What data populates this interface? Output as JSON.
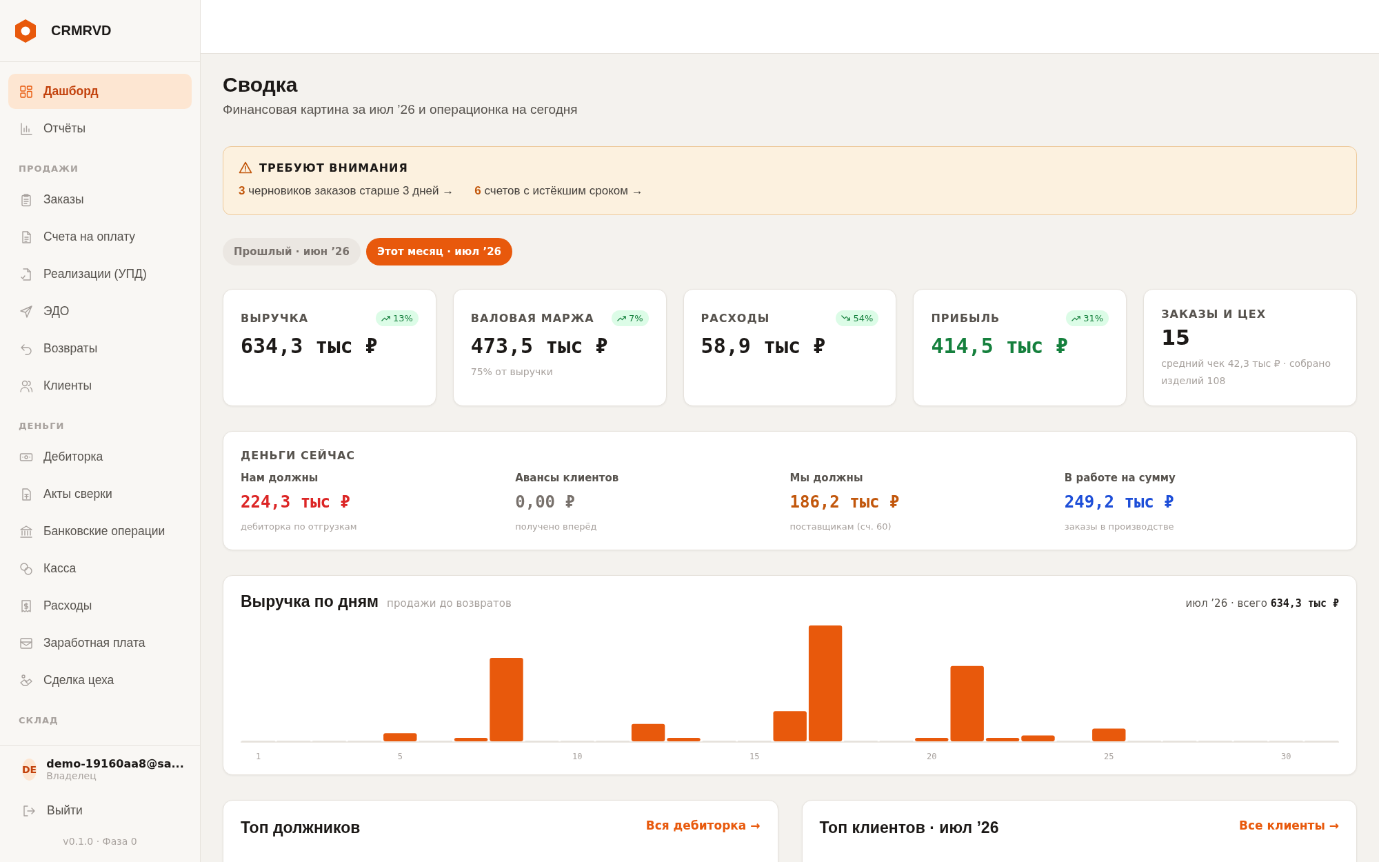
{
  "brand": {
    "name": "CRMRVD"
  },
  "sidebar": {
    "items": [
      {
        "kind": "item",
        "label": "Дашборд",
        "selected": true
      },
      {
        "kind": "item",
        "label": "Отчёты",
        "selected": false
      },
      {
        "kind": "section",
        "label": "ПРОДАЖИ"
      },
      {
        "kind": "item",
        "label": "Заказы",
        "selected": false
      },
      {
        "kind": "item",
        "label": "Счета на оплату",
        "selected": false
      },
      {
        "kind": "item",
        "label": "Реализации (УПД)",
        "selected": false
      },
      {
        "kind": "item",
        "label": "ЭДО",
        "selected": false
      },
      {
        "kind": "item",
        "label": "Возвраты",
        "selected": false
      },
      {
        "kind": "item",
        "label": "Клиенты",
        "selected": false
      },
      {
        "kind": "section",
        "label": "ДЕНЬГИ"
      },
      {
        "kind": "item",
        "label": "Дебиторка",
        "selected": false
      },
      {
        "kind": "item",
        "label": "Акты сверки",
        "selected": false
      },
      {
        "kind": "item",
        "label": "Банковские операции",
        "selected": false
      },
      {
        "kind": "item",
        "label": "Касса",
        "selected": false
      },
      {
        "kind": "item",
        "label": "Расходы",
        "selected": false
      },
      {
        "kind": "item",
        "label": "Заработная плата",
        "selected": false
      },
      {
        "kind": "item",
        "label": "Сделка цеха",
        "selected": false
      },
      {
        "kind": "section",
        "label": "СКЛАД"
      }
    ]
  },
  "user": {
    "initials": "DE",
    "email": "demo-19160aa8@sa...",
    "role": "Владелец"
  },
  "logout": "Выйти",
  "version": "v0.1.0 · Фаза 0",
  "page": {
    "title": "Сводка",
    "subtitle": "Финансовая картина за июл ’26 и операционка на сегодня"
  },
  "alert": {
    "title": "ТРЕБУЮТ ВНИМАНИЯ",
    "items": [
      {
        "count": "3",
        "text": "черновиков заказов старше 3 дней →"
      },
      {
        "count": "6",
        "text": "счетов с истёкшим сроком →"
      }
    ]
  },
  "periods": [
    {
      "label": "Прошлый · июн ’26",
      "selected": false
    },
    {
      "label": "Этот месяц · июл ’26",
      "selected": true
    }
  ],
  "kpis": [
    {
      "kind": "money",
      "label": "ВЫРУЧКА",
      "value": "634,3 тыс ₽",
      "color": "#1c1917",
      "trend": {
        "rising": true,
        "text": "13%"
      }
    },
    {
      "kind": "money",
      "label": "ВАЛОВАЯ МАРЖА",
      "value": "473,5 тыс ₽",
      "color": "#1c1917",
      "trend": {
        "rising": true,
        "text": "7%"
      },
      "note": "75% от выручки"
    },
    {
      "kind": "money",
      "label": "РАСХОДЫ",
      "value": "58,9 тыс ₽",
      "color": "#1c1917",
      "trend": {
        "rising": false,
        "text": "54%"
      }
    },
    {
      "kind": "money",
      "label": "ПРИБЫЛЬ",
      "value": "414,5 тыс ₽",
      "color": "#15803d",
      "trend": {
        "rising": true,
        "text": "31%"
      }
    },
    {
      "kind": "count",
      "label": "ЗАКАЗЫ И ЦЕХ",
      "value": "15",
      "color": "#1c1917",
      "note": "средний чек 42,3 тыс ₽ · собрано изделий 108"
    }
  ],
  "money_now": {
    "title": "ДЕНЬГИ СЕЙЧАС",
    "items": [
      {
        "label": "Нам должны",
        "value": "224,3 тыс ₽",
        "color": "#dc2626",
        "note": "дебиторка по отгрузкам"
      },
      {
        "label": "Авансы клиентов",
        "value": "0,00 ₽",
        "color": "#78716c",
        "note": "получено вперёд"
      },
      {
        "label": "Мы должны",
        "value": "186,2 тыс ₽",
        "color": "#c2570c",
        "note": "поставщикам (сч. 60)"
      },
      {
        "label": "В работе на сумму",
        "value": "249,2 тыс ₽",
        "color": "#1d4ed8",
        "note": "заказы в производстве"
      }
    ]
  },
  "revenue_chart": {
    "title": "Выручка по дням",
    "subtitle": "продажи до возвратов",
    "total_prefix": "июл ’26 · всего",
    "total": "634,3 тыс ₽",
    "x_labels": [
      "1",
      "5",
      "10",
      "15",
      "20",
      "25",
      "30"
    ]
  },
  "bottom_cards": [
    {
      "title": "Топ должников",
      "link": "Вся дебиторка →"
    },
    {
      "title": "Топ клиентов · июл ’26",
      "link": "Все клиенты →"
    }
  ]
}
